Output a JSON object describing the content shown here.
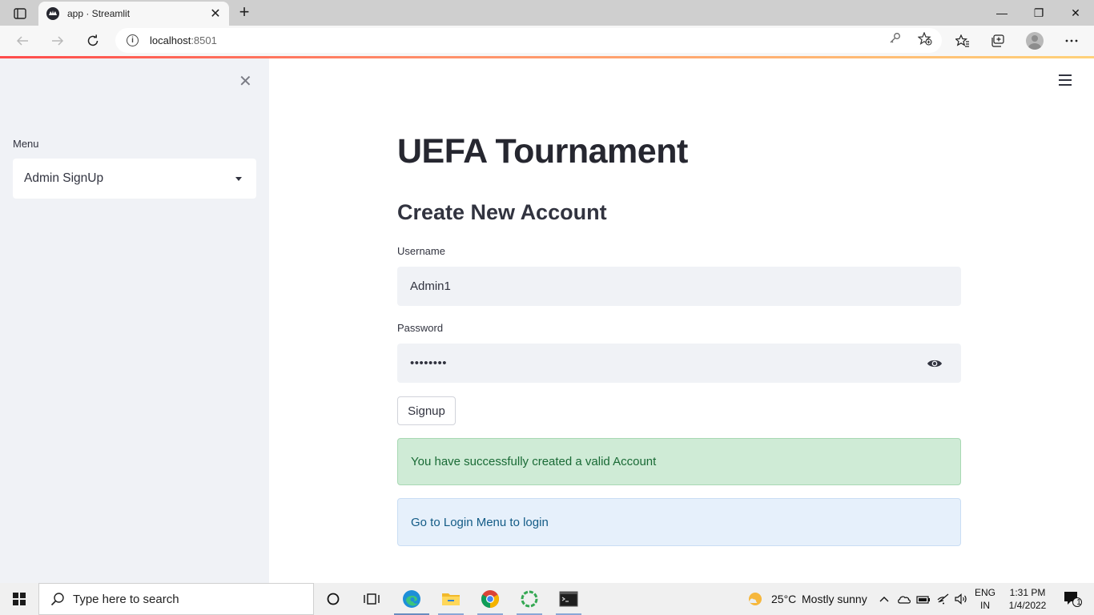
{
  "browser": {
    "tab_title": "app · Streamlit",
    "tab_close": "✕",
    "new_tab": "+",
    "url_host": "localhost",
    "url_port": ":8501",
    "window_controls": {
      "minimize": "—",
      "restore": "❐",
      "close": "✕"
    }
  },
  "sidebar": {
    "close": "✕",
    "menu_label": "Menu",
    "menu_selected": "Admin SignUp"
  },
  "main": {
    "title": "UEFA Tournament",
    "subtitle": "Create New Account",
    "username_label": "Username",
    "username_value": "Admin1",
    "password_label": "Password",
    "password_value": "••••••••",
    "signup_button": "Signup",
    "success_message": "You have successfully created a valid Account",
    "info_message": "Go to Login Menu to login"
  },
  "taskbar": {
    "search_placeholder": "Type here to search",
    "weather_temp": "25°C",
    "weather_text": "Mostly sunny",
    "lang_top": "ENG",
    "lang_bottom": "IN",
    "time": "1:31 PM",
    "date": "1/4/2022",
    "notification_count": "1"
  },
  "icons": {
    "tab_actions": "tab-actions-icon",
    "back": "back-arrow-icon",
    "forward": "forward-arrow-icon",
    "reload": "reload-icon",
    "eye": "eye-icon",
    "hamburger": "hamburger-icon"
  }
}
